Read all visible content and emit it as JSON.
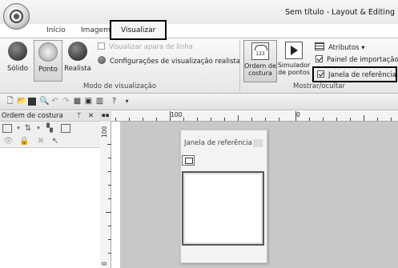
{
  "window": {
    "title": "Sem título - Layout & Editing"
  },
  "tabs": [
    "Início",
    "Imagem",
    "Visualizar"
  ],
  "ribbon": {
    "modo": {
      "group_label": "Modo de visualização",
      "buttons": [
        "Sólido",
        "Ponto",
        "Realista"
      ],
      "selected": "Ponto",
      "visualizar_apara": "Visualizar apara de linha",
      "config_realista": "Configurações de visualização realista"
    },
    "mostrar": {
      "group_label": "Mostrar/ocultar",
      "ordem_line1": "Ordem de",
      "ordem_line2": "costura",
      "ordem_icon_text": "123",
      "simulador_line1": "Simulador",
      "simulador_line2": "de pontos",
      "atributos": "Atributos ▾",
      "painel_importacao": "Painel de importação",
      "janela_referencia": "Janela de referência",
      "painel_importacao_checked": true,
      "janela_referencia_checked": true
    }
  },
  "qat_icons": [
    "new-file-icon",
    "open-folder-icon",
    "save-icon",
    "zoom-icon",
    "undo-icon",
    "redo-icon",
    "grid-icon",
    "window-icon",
    "layout-icon",
    "help-icon",
    "dropdown-icon"
  ],
  "left_pane": {
    "title": "Ordem de costura",
    "pin": "ᛘ",
    "close": "✕"
  },
  "ruler": {
    "h_labels": [
      "100",
      "0"
    ],
    "v_labels": [
      "100",
      "0"
    ]
  },
  "reference_window": {
    "title": "Janela de referência"
  },
  "colors": {
    "highlight_border": "#000000",
    "canvas_gray": "#c8c8c8",
    "ribbon_bg": "#eeeeee"
  }
}
